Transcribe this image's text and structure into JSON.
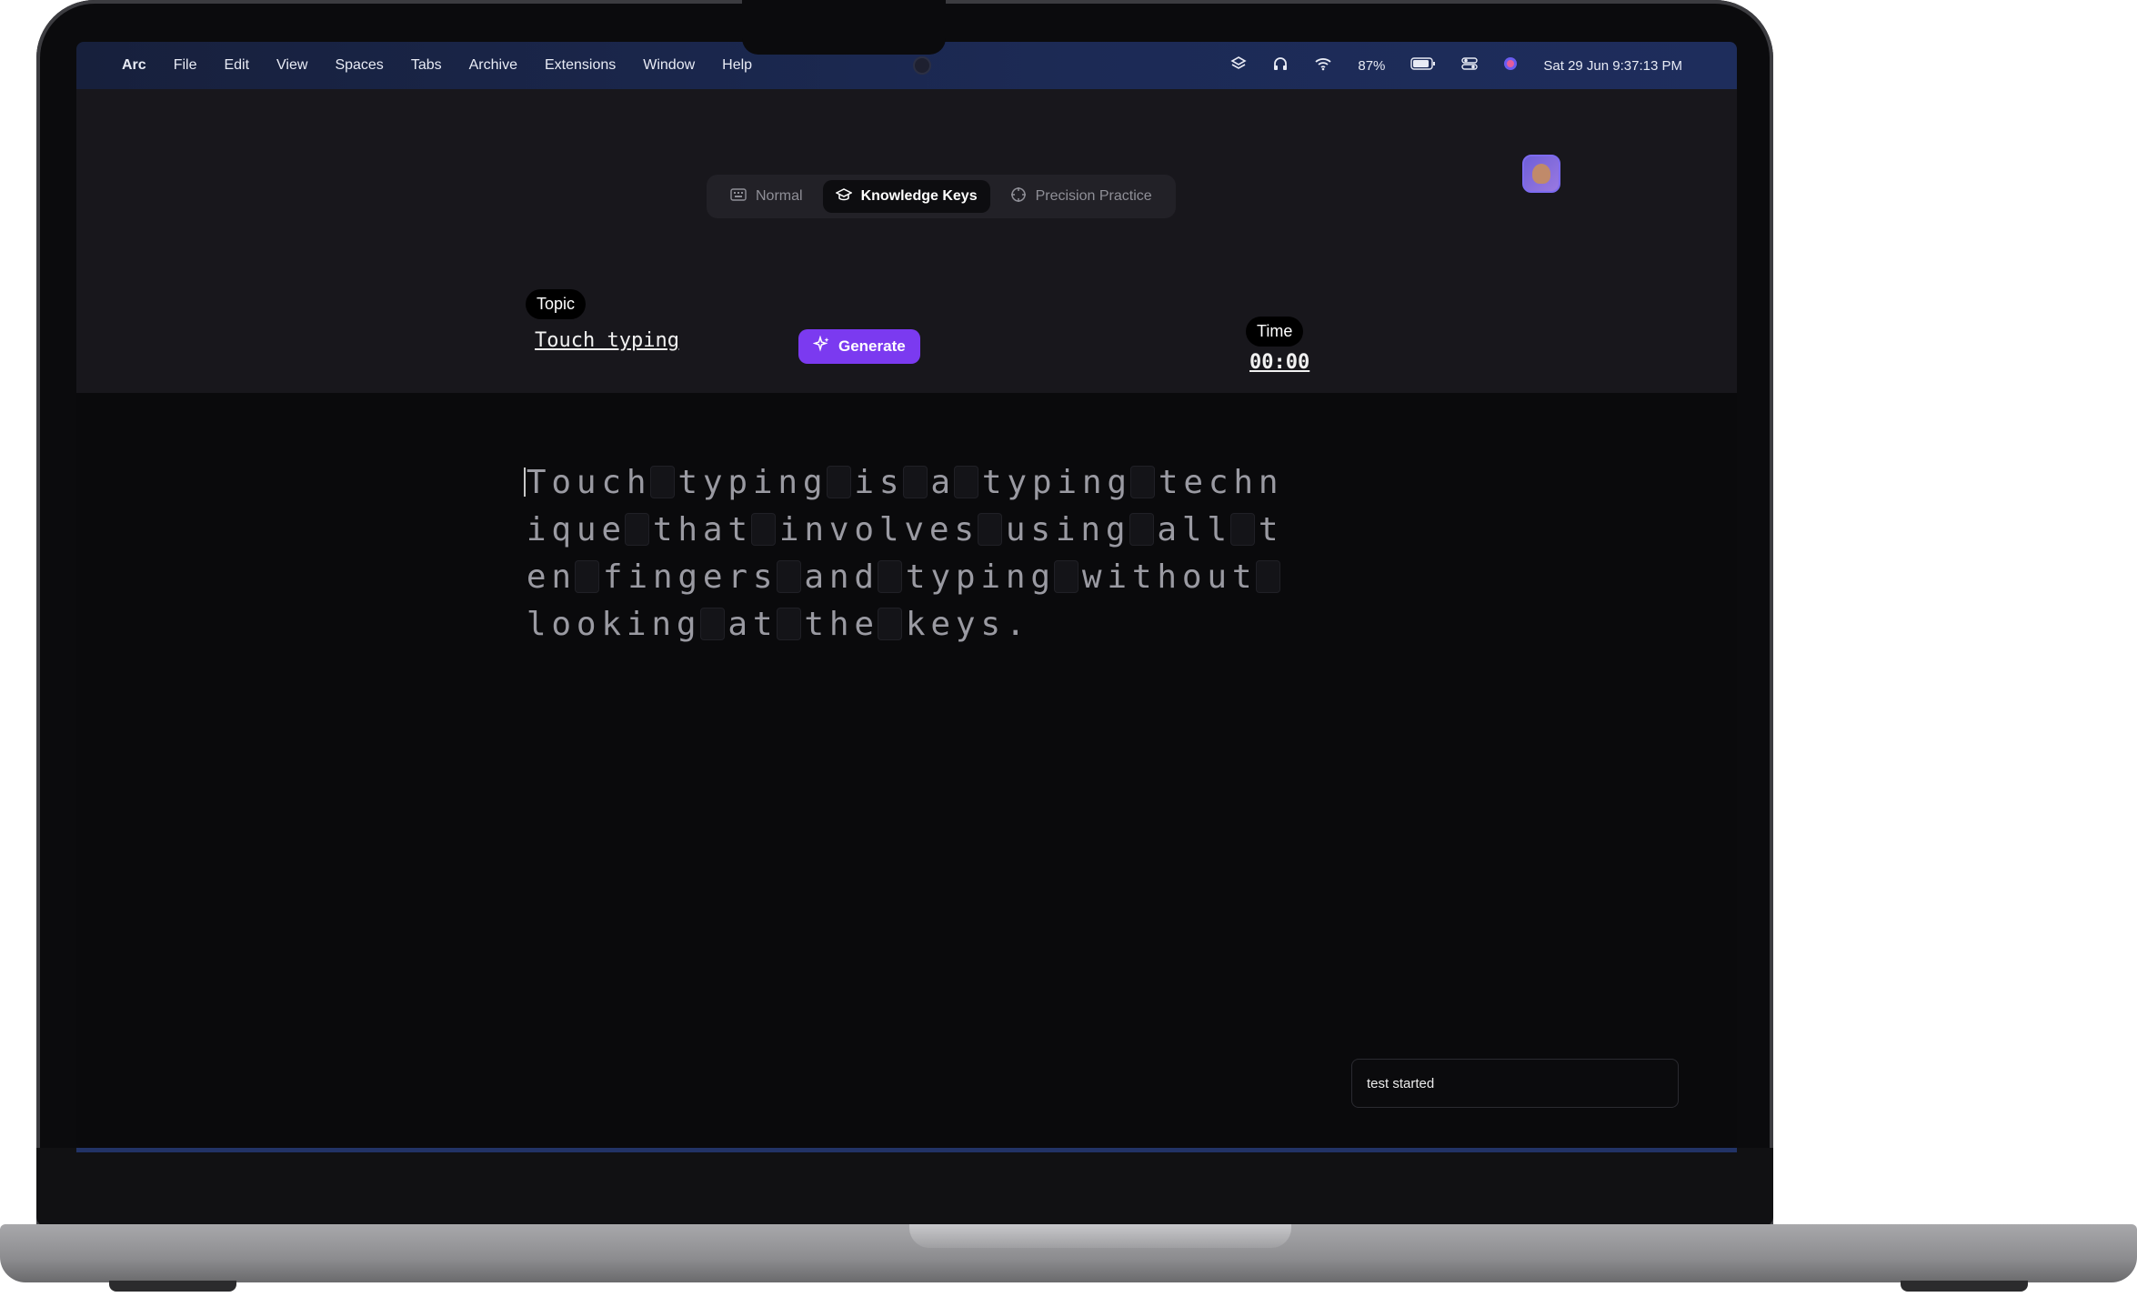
{
  "menubar": {
    "app": "Arc",
    "menus": [
      "File",
      "Edit",
      "View",
      "Spaces",
      "Tabs",
      "Archive",
      "Extensions",
      "Window",
      "Help"
    ],
    "battery": "87%",
    "datetime": "Sat 29 Jun  9:37:13 PM"
  },
  "modes": [
    {
      "label": "Normal",
      "icon": "keyboard-icon",
      "active": false
    },
    {
      "label": "Knowledge Keys",
      "icon": "graduation-cap-icon",
      "active": true
    },
    {
      "label": "Precision Practice",
      "icon": "crosshair-icon",
      "active": false
    }
  ],
  "topic": {
    "label": "Topic",
    "value": "Touch typing"
  },
  "generate_label": "Generate",
  "time": {
    "label": "Time",
    "value": "00:00"
  },
  "typing_lines": [
    "Touch typing is a typing techn",
    "ique that involves using all t",
    "en fingers and typing without ",
    "looking at the keys."
  ],
  "toast": "test started"
}
